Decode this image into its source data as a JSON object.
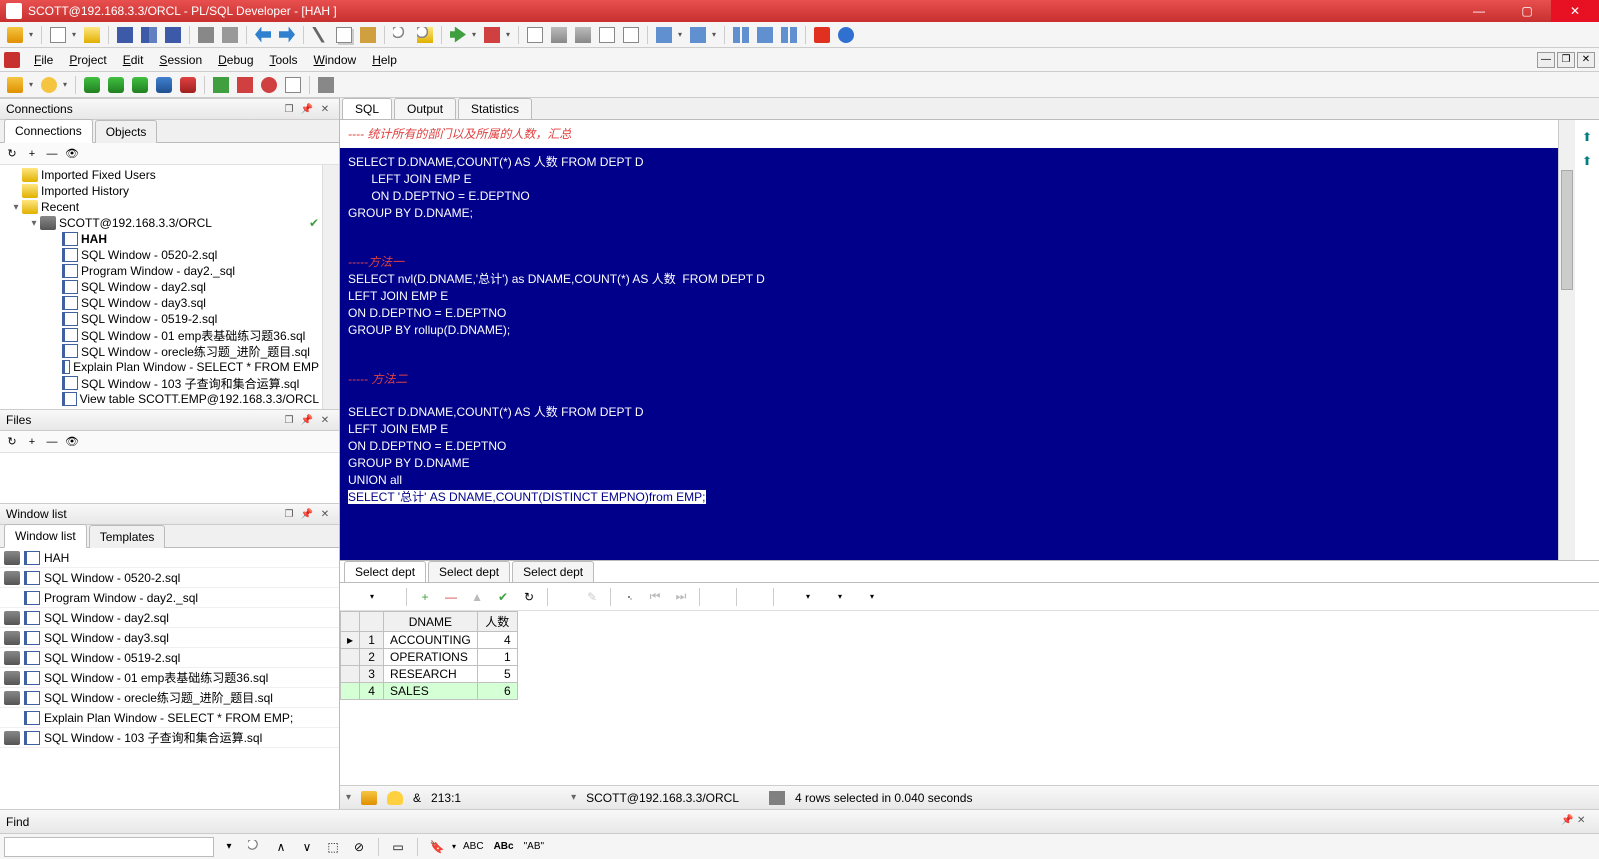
{
  "titlebar": {
    "text": "SCOTT@192.168.3.3/ORCL - PL/SQL Developer - [HAH ]"
  },
  "menubar": {
    "file": "File",
    "project": "Project",
    "edit": "Edit",
    "session": "Session",
    "debug": "Debug",
    "tools": "Tools",
    "window": "Window",
    "help": "Help"
  },
  "panels": {
    "connections": "Connections",
    "files": "Files",
    "windowlist": "Window list"
  },
  "conn_tabs": {
    "connections": "Connections",
    "objects": "Objects"
  },
  "tree": {
    "imported_fixed": "Imported Fixed Users",
    "imported_history": "Imported History",
    "recent": "Recent",
    "scott": "SCOTT@192.168.3.3/ORCL",
    "items": [
      "HAH",
      "SQL Window - 0520-2.sql",
      "Program Window - day2._sql",
      "SQL Window - day2.sql",
      "SQL Window - day3.sql",
      "SQL Window - 0519-2.sql",
      "SQL Window - 01 emp表基础练习题36.sql",
      "SQL Window - orecle练习题_进阶_题目.sql",
      "Explain Plan Window - SELECT * FROM EMP",
      "SQL Window - 103 子查询和集合运算.sql",
      "View table SCOTT.EMP@192.168.3.3/ORCL"
    ]
  },
  "wl_tabs": {
    "windowlist": "Window list",
    "templates": "Templates"
  },
  "wl_items": [
    "HAH",
    "SQL Window - 0520-2.sql",
    "Program Window - day2._sql",
    "SQL Window - day2.sql",
    "SQL Window - day3.sql",
    "SQL Window - 0519-2.sql",
    "SQL Window - 01 emp表基础练习题36.sql",
    "SQL Window - orecle练习题_进阶_题目.sql",
    "Explain Plan Window - SELECT * FROM EMP;",
    "SQL Window - 103 子查询和集合运算.sql"
  ],
  "editor_tabs": {
    "sql": "SQL",
    "output": "Output",
    "statistics": "Statistics"
  },
  "sql": {
    "c1": "---- 统计所有的部门以及所属的人数，汇总",
    "l1": "SELECT D.DNAME,COUNT(*) AS 人数 FROM DEPT D",
    "l2": "       LEFT JOIN EMP E",
    "l3": "       ON D.DEPTNO = E.DEPTNO",
    "l4": "GROUP BY D.DNAME;",
    "c2": "-----方法一",
    "l5": "SELECT nvl(D.DNAME,'总计') as DNAME,COUNT(*) AS 人数  FROM DEPT D",
    "l6": "LEFT JOIN EMP E",
    "l7": "ON D.DEPTNO = E.DEPTNO",
    "l8": "GROUP BY rollup(D.DNAME);",
    "c3": "----- 方法二",
    "l9": "SELECT D.DNAME,COUNT(*) AS 人数 FROM DEPT D",
    "l10": "LEFT JOIN EMP E",
    "l11": "ON D.DEPTNO = E.DEPTNO",
    "l12": "GROUP BY D.DNAME",
    "l13": "UNION all",
    "l14": "SELECT '总计' AS DNAME,COUNT(DISTINCT EMPNO)from EMP;"
  },
  "result_tabs": {
    "t1": "Select dept",
    "t2": "Select dept",
    "t3": "Select dept"
  },
  "grid": {
    "cols": [
      "DNAME",
      "人数"
    ],
    "rows": [
      {
        "n": "1",
        "dname": "ACCOUNTING",
        "cnt": "4"
      },
      {
        "n": "2",
        "dname": "OPERATIONS",
        "cnt": "1"
      },
      {
        "n": "3",
        "dname": "RESEARCH",
        "cnt": "5"
      },
      {
        "n": "4",
        "dname": "SALES",
        "cnt": "6"
      }
    ]
  },
  "status": {
    "pos": "213:1",
    "conn": "SCOTT@192.168.3.3/ORCL",
    "msg": "4 rows selected in 0.040 seconds",
    "and": "&"
  },
  "findbar": {
    "title": "Find",
    "abc": "ABC",
    "abc2": "ABc",
    "q": "\"AB\""
  }
}
